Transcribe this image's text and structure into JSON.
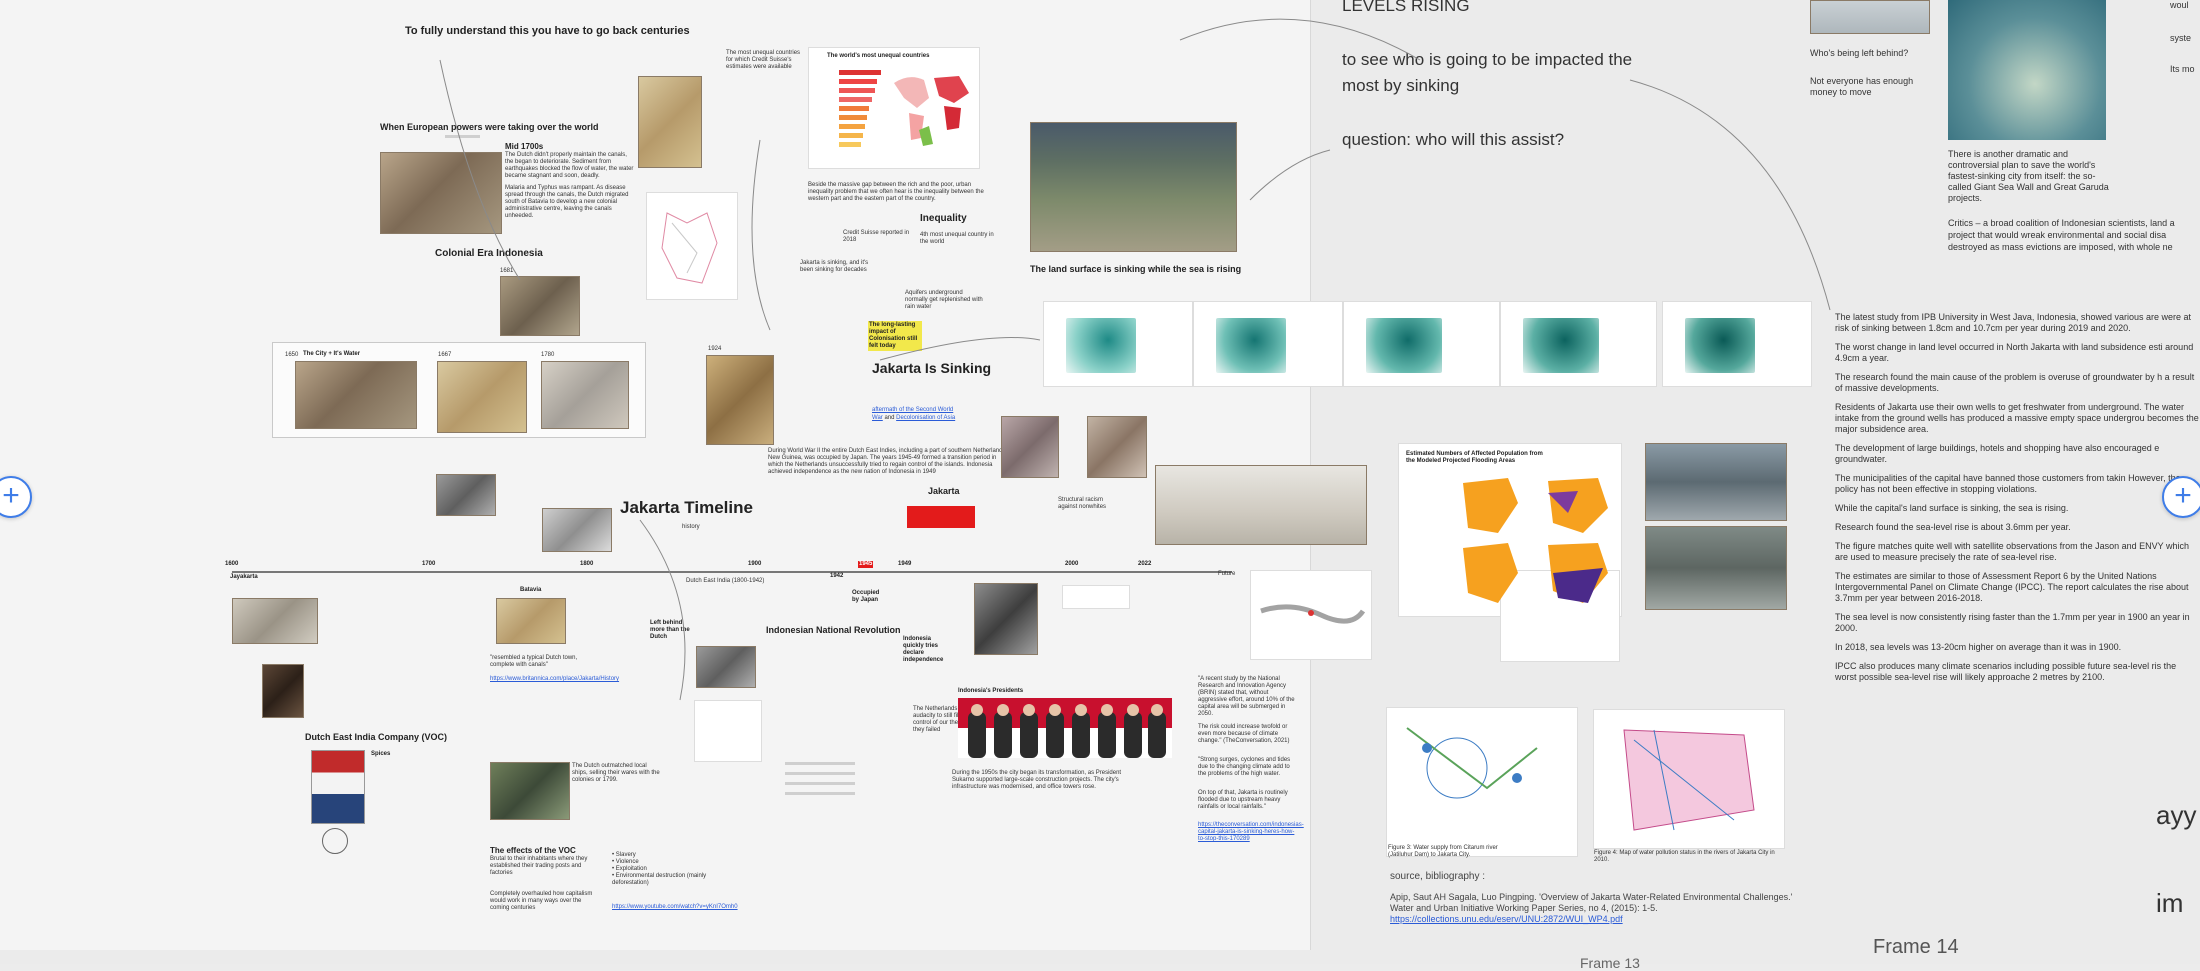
{
  "left_frame": {
    "title_centuries": "To fully  understand this you have to go back centuries",
    "heading_european": "When European powers were taking over the world",
    "mid1700s_title": "Mid 1700s",
    "mid1700s_text": "The Dutch didn't properly maintain the canals, the began to deteriorate. Sediment from earthquakes blocked the flow of water, the water became stagnant and soon, deadly.",
    "mid1700s_text2": "Malaria and Typhus was rampant. As disease spread through the canals, the Dutch migrated south of Batavia to develop a new colonial administrative centre, leaving the canals unheeded.",
    "colonial_era": "Colonial Era Indonesia",
    "year_1681": "1681",
    "unequal_title": "The world's most unequal countries",
    "inequality": "Inequality",
    "land_sinking_caption": "The land surface is sinking while the sea is rising",
    "jakarta_sinking": "Jakarta Is Sinking",
    "highlight_note": "The long-lasting impact of Colonisation still felt today",
    "aftermath_link1": "aftermath of the Second World",
    "aftermath_link2": "War",
    "aftermath_and": "and",
    "aftermath_link3": "Decolonisation of Asia",
    "jakarta_label": "Jakarta",
    "jakarta_timeline": "Jakarta Timeline",
    "history": "history",
    "city_canals": "The City + It's Water",
    "year_1650": "1650",
    "year_1667": "1667",
    "year_1780": "1780",
    "year_1924": "1924",
    "years": [
      "1600",
      "1700",
      "1800",
      "1900",
      "1942",
      "1945",
      "1949",
      "2000",
      "2022",
      "Future"
    ],
    "dutch_east_india": "Dutch East India (1800-1942)",
    "occupied_japan": "Occupied by Japan",
    "batavia": "Batavia",
    "jayakarta": "Jayakarta",
    "indonesian_revolution": "Indonesian National Revolution",
    "indonesian_presidents": "Indonesia's Presidents",
    "dutch_voc": "Dutch East India Company (VOC)",
    "spices": "Spices",
    "effects_voc_title": "The effects of the VOC",
    "effects_voc_text": "Brutal to their inhabitants where they established their trading posts and factories",
    "overhauled": "Completely overhauled how capitalism would work in many ways over the coming centuries",
    "bullets": [
      "Slavery",
      "Violence",
      "Exploitation",
      "Environmental destruction (mainly deforestation)"
    ],
    "youtube_link": "https://www.youtube.com/watch?v=yKnI7Omh0",
    "britannica_quote": "\"resembled a typical Dutch town, complete with canals\"",
    "britannica_link": "https://www.britannica.com/place/Jakarta/History",
    "left_behind": "Left behind more than the Dutch",
    "indonesia_quickly": "Indonesia quickly tries declare independence",
    "netherlands_text": "The Netherlands have the audacity to still film try regain control of our the islands! they failed",
    "structural_racism": "Structural racism against nonwhites",
    "research_quote": "\"A recent study by the National Research and Innovation Agency (BRIN) stated that, without aggressive effort, around 10% of the capital area will be submerged in 2050.",
    "research_quote2": "The risk could increase twofold or even more because of climate change.\" (TheConversation, 2021)",
    "research_quote3": "\"Strong surges, cyclones and tides due to the changing climate add to the problems of the high water.",
    "research_quote4": "On top of that, Jakarta is routinely flooded due to upstream heavy rainfalls or local rainfalls.\"",
    "conversation_link": "https://theconversation.com/indonesias-capital-jakarta-is-sinking-heres-how-to-stop-this-170289",
    "sinking_1950s": "During the 1950s the city began its transformation, as President Sukarno supported large-scale construction projects. The city's infrastructure was modernised, and office towers rose.",
    "estimated_title": "Estimated Numbers of Affected Population from the Modeled Projected Flooding Areas"
  },
  "middle_notes": {
    "levels_rising": "LEVELS RISING",
    "to_see_impacted": "to see who is going to be impacted the most by sinking",
    "question_assist": "question: who will this assist?",
    "source_bib": "source, bibliography :",
    "citation": "Apip, Saut AH Sagala, Luo Pingping. 'Overview of Jakarta Water-Related Environmental Challenges.' Water and Urban Initiative Working Paper Series, no 4, (2015): 1-5.",
    "citation_link": "https://collections.unu.edu/eserv/UNU:2872/WUI_WP4.pdf",
    "fig_a": "Figure 3: Water supply from Citarum river (Jatiluhur Dam) to Jakarta City.",
    "fig_b": "Figure 4: Map of water pollution status in the rivers of Jakarta City in 2010."
  },
  "right_frame": {
    "left_behind": "Who's being left behind?",
    "not_everyone": "Not everyone has enough money to move",
    "garuda_text": "There is another dramatic and controversial plan to save the world's fastest-sinking city from itself: the so-called Giant Sea Wall and Great Garuda projects.",
    "critics_text": "Critics – a broad coalition of Indonesian scientists, land a project that would wreak environmental and social disa destroyed as mass evictions are imposed, with whole ne",
    "top_right_1": "woul",
    "top_right_2": "syste",
    "top_right_3": "Its mo",
    "paragraphs": [
      "The latest study from IPB University in West Java, Indonesia, showed various are were at risk of sinking between 1.8cm and 10.7cm per year during 2019 and 2020.",
      "The worst change in land level occurred in North Jakarta with land subsidence esti around 4.9cm a year.",
      "The research found the main cause of the problem is overuse of groundwater by h a result of massive developments.",
      "Residents of Jakarta use their own wells to get freshwater from underground. The water intake from the ground wells has produced a massive empty space undergrou becomes the major subsidence area.",
      "The development of large buildings, hotels and shopping have also encouraged e groundwater.",
      "The municipalities of the capital have banned those customers from takin However, the policy has not been effective in stopping violations.",
      "While the capital's land surface is sinking, the sea is rising.",
      "Research found the sea-level rise is about 3.6mm per year.",
      "The figure matches quite well with satellite observations from the Jason and ENVY which are used to measure precisely the rate of sea-level rise.",
      "The estimates are similar to those of Assessment Report 6 by the United Nations Intergovernmental Panel on Climate Change (IPCC). The report calculates the rise about 3.7mm per year between 2016-2018.",
      "The sea level is now consistently rising faster than the 1.7mm per year in 1900 an year in 2000.",
      "In 2018, sea levels was 13-20cm higher on average than it was in 1900.",
      "IPCC also produces many climate scenarios including possible future sea-level ris the worst possible sea-level rise will likely approache 2 metres by 2100."
    ],
    "ayy": "ayy",
    "im": "im",
    "frame_label": "Frame 14",
    "frame_label_2": "Frame 13"
  },
  "controls": {
    "add_left": "+",
    "add_right": "+"
  },
  "colors": {
    "link": "#2a5bd7",
    "highlight": "#f2e84b",
    "red_block": "#e31b1b",
    "plus_accent": "#3f7de8"
  }
}
